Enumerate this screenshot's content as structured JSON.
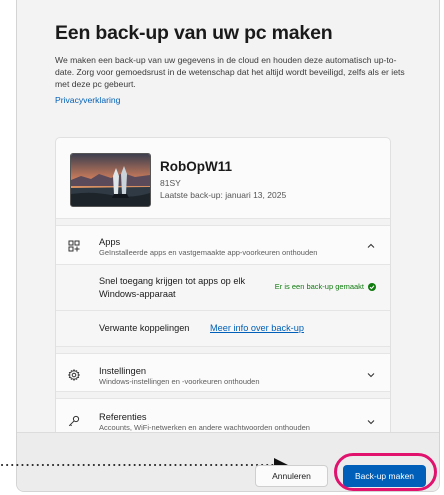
{
  "dialog": {
    "title": "Een back-up van uw pc maken",
    "description": "We maken een back-up van uw gegevens in de cloud en houden deze automatisch up-to-date. Zorg voor gemoedsrust in de wetenschap dat het altijd wordt beveiligd, zelfs als er iets met deze pc gebeurt.",
    "privacy_link": "Privacyverklaring"
  },
  "device": {
    "name": "RobOpW11",
    "model": "81SY",
    "last_backup": "Laatste back-up: januari 13, 2025"
  },
  "sections": {
    "apps": {
      "icon": "apps-grid-icon",
      "title": "Apps",
      "subtitle": "Geïnstalleerde apps en vastgemaakte app-voorkeuren onthouden",
      "expanded": true,
      "quick_access_label": "Snel toegang krijgen tot apps op elk Windows-apparaat",
      "status_text": "Er is een back-up gemaakt",
      "related_label": "Verwante koppelingen",
      "related_link": "Meer info over back-up"
    },
    "settings": {
      "icon": "gear-icon",
      "title": "Instellingen",
      "subtitle": "Windows-instellingen en -voorkeuren onthouden",
      "expanded": false
    },
    "credentials": {
      "icon": "key-icon",
      "title": "Referenties",
      "subtitle": "Accounts, WiFi-netwerken en andere wachtwoorden onthouden",
      "expanded": false
    }
  },
  "buttons": {
    "cancel": "Annuleren",
    "backup": "Back-up maken"
  },
  "colors": {
    "accent": "#005fb8",
    "success": "#0f7b0f",
    "annotation_highlight": "#e0126e"
  }
}
